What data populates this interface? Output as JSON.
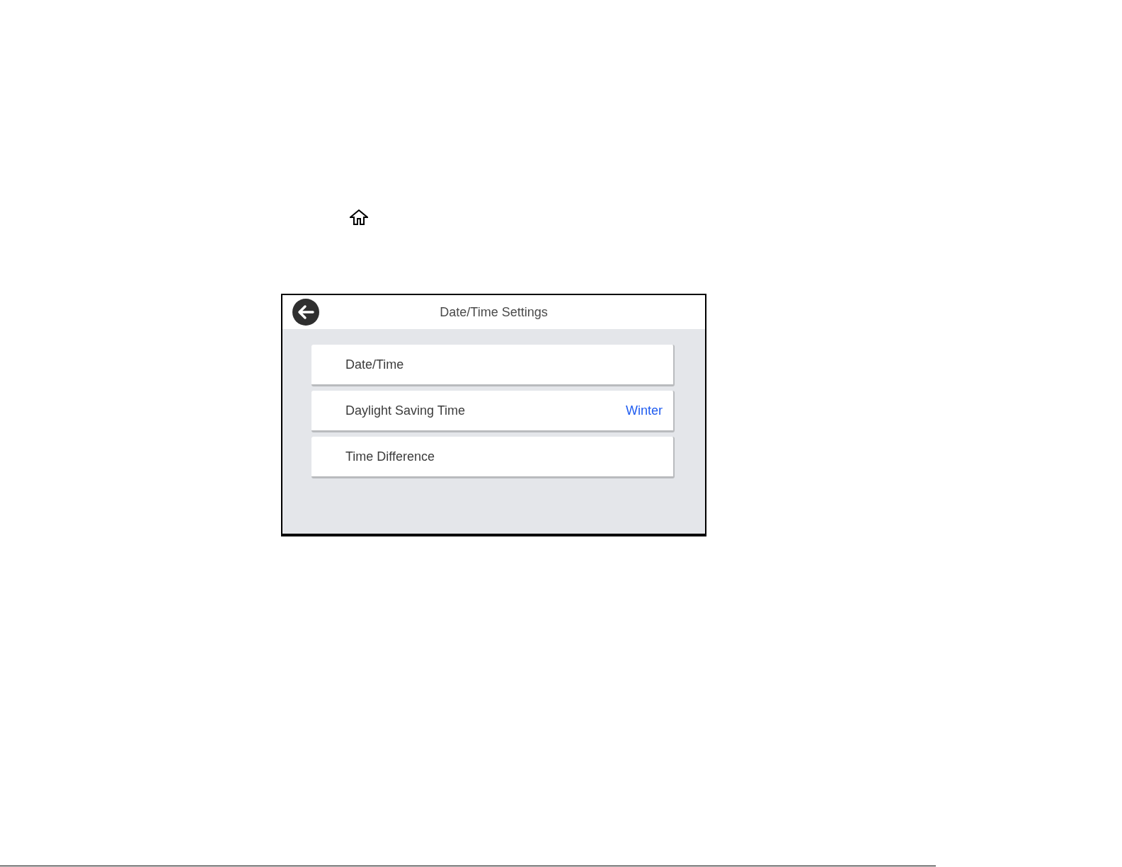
{
  "screen": {
    "title": "Date/Time Settings",
    "items": [
      {
        "label": "Date/Time"
      },
      {
        "label": "Daylight Saving Time",
        "value": "Winter"
      },
      {
        "label": "Time Difference"
      }
    ]
  }
}
